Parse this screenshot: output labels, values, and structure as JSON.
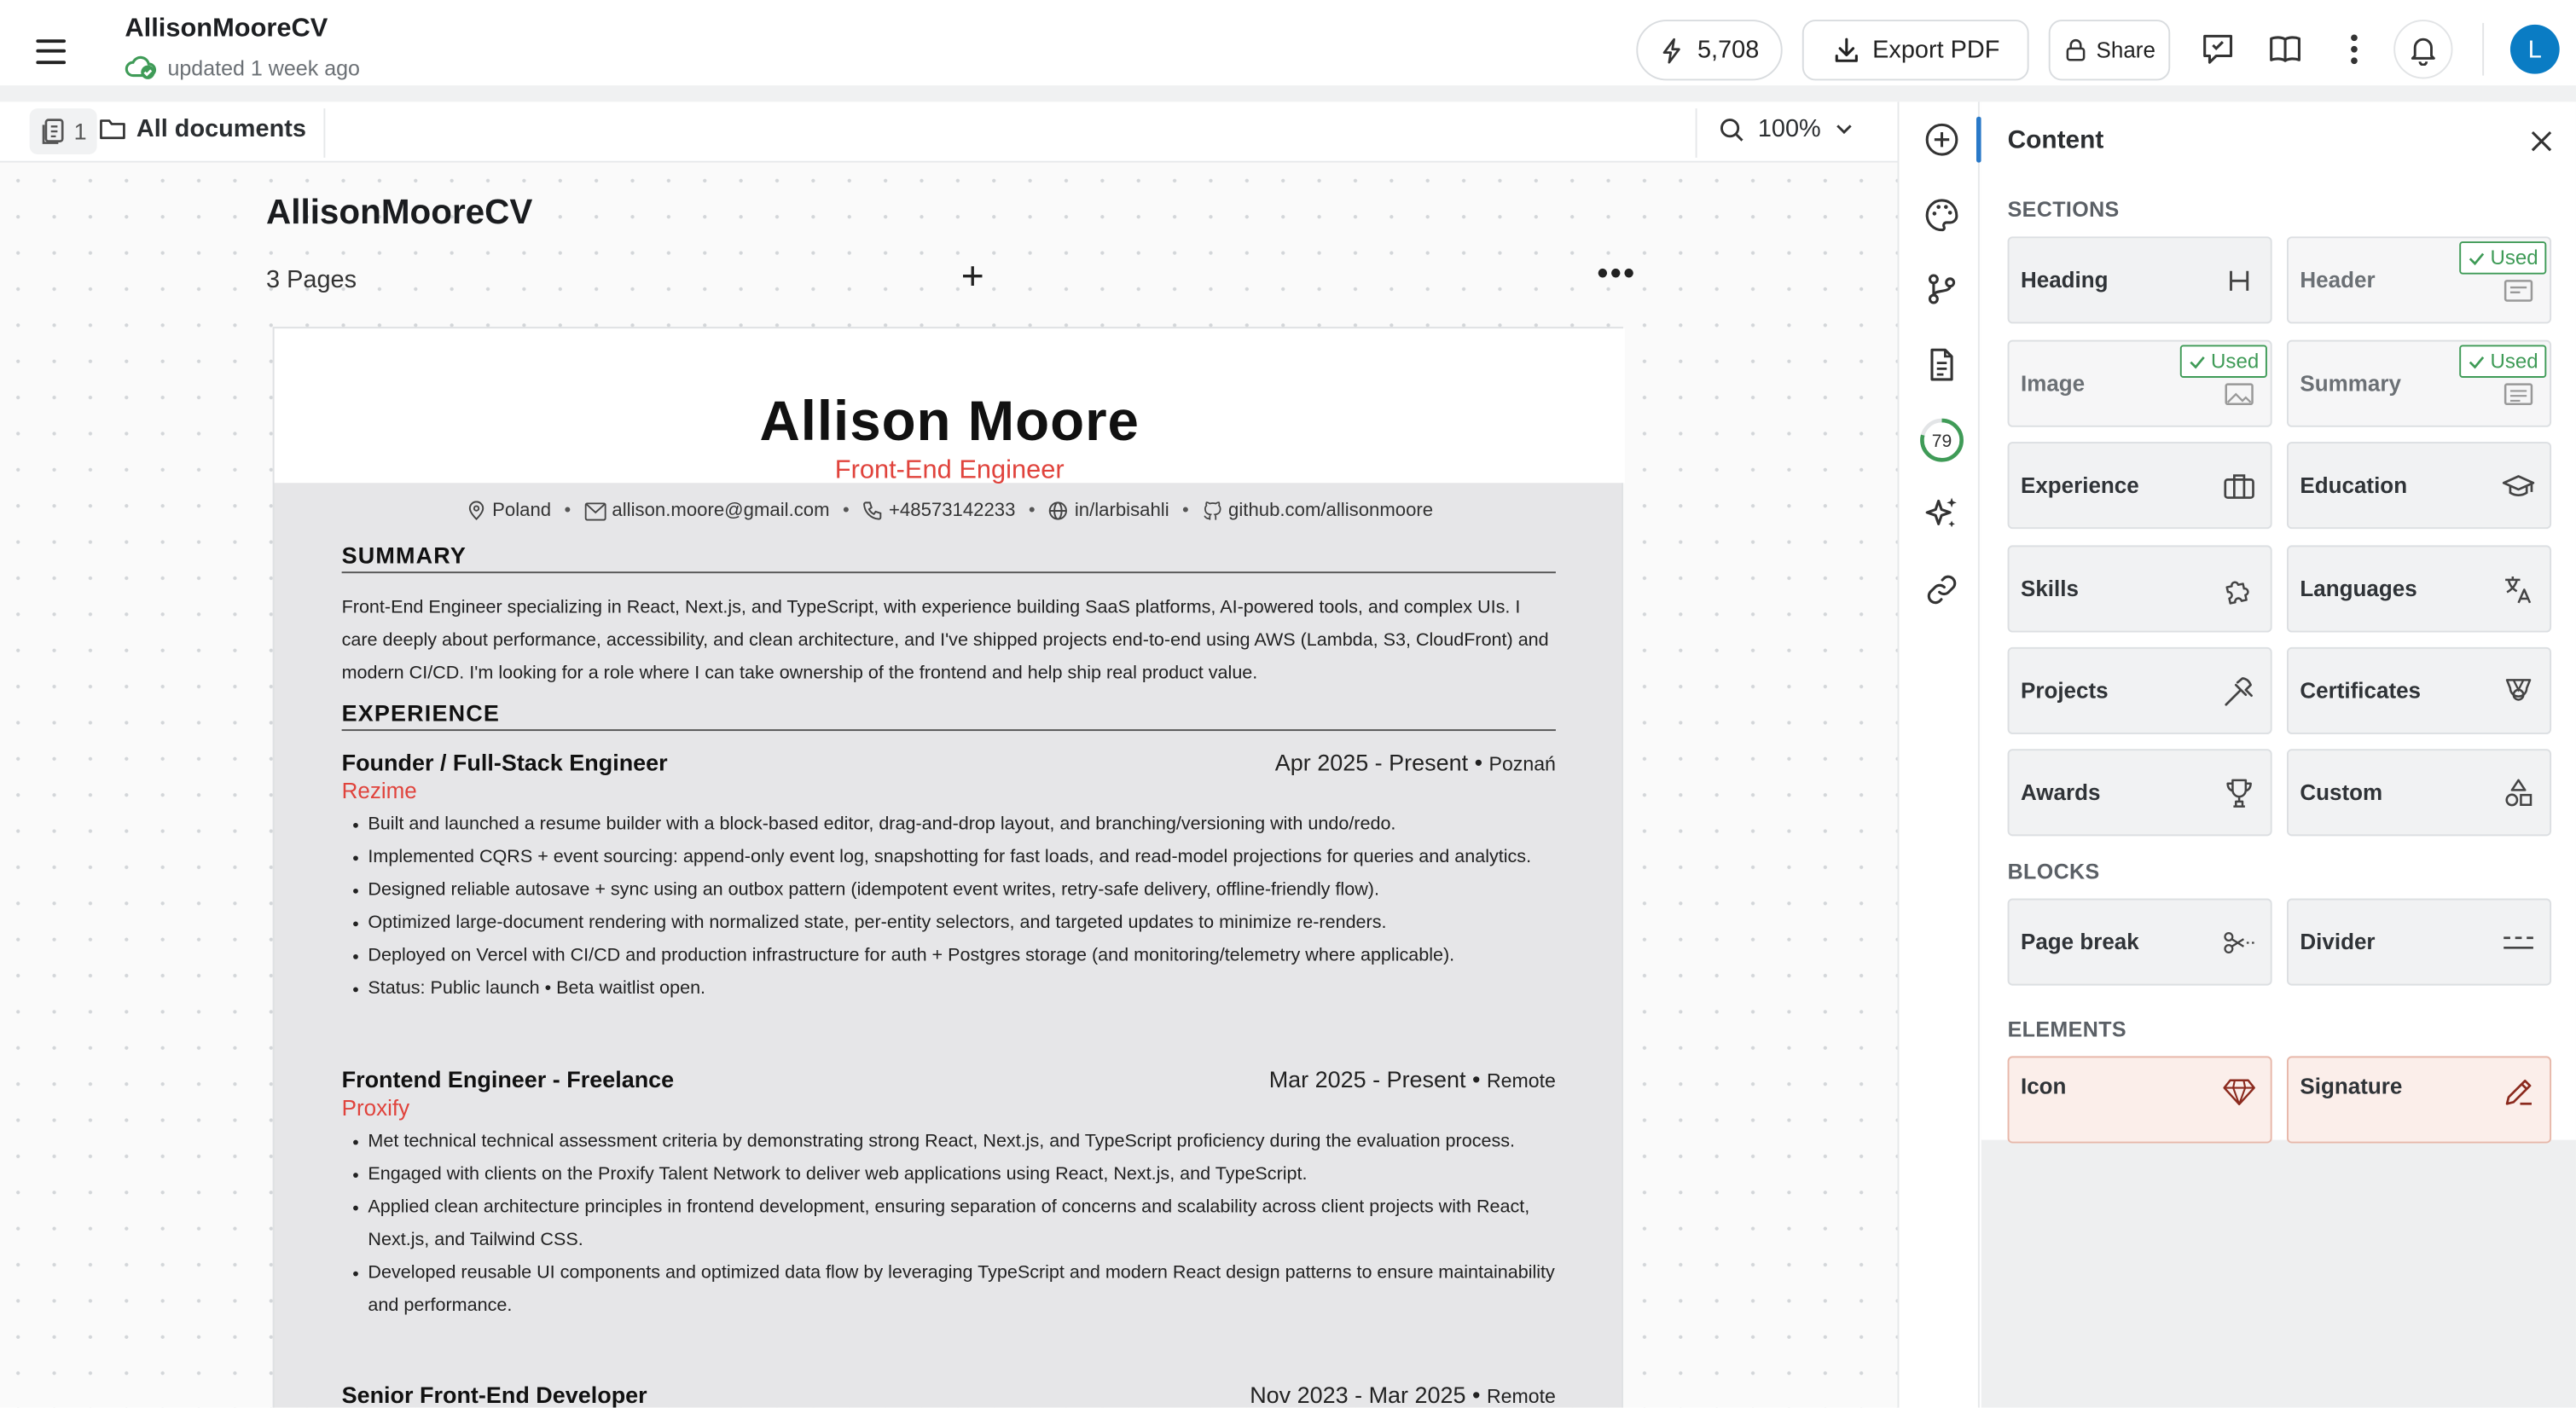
{
  "topbar": {
    "doc_title": "AllisonMooreCV",
    "status": "updated 1 week ago",
    "credits": "5,708",
    "export_label": "Export PDF",
    "share_label": "Share",
    "avatar_initial": "L"
  },
  "subbar": {
    "page_count": "1",
    "all_documents": "All documents",
    "zoom": "100%"
  },
  "canvas": {
    "title": "AllisonMooreCV",
    "pages_label": "3 Pages"
  },
  "resume": {
    "name": "Allison Moore",
    "role": "Front-End Engineer",
    "contacts": {
      "location": "Poland",
      "email": "allison.moore@gmail.com",
      "phone": "+48573142233",
      "linkedin": "in/larbisahli",
      "github": "github.com/allisonmoore"
    },
    "summary_heading": "SUMMARY",
    "summary": "Front-End Engineer specializing in React, Next.js, and TypeScript, with experience building SaaS platforms, AI-powered tools, and complex UIs. I care deeply about performance, accessibility, and clean architecture, and I've shipped projects end-to-end using AWS (Lambda, S3, CloudFront) and modern CI/CD. I'm looking for a role where I can take ownership of the frontend and help ship real product value.",
    "experience_heading": "EXPERIENCE",
    "jobs": [
      {
        "title": "Founder / Full-Stack Engineer",
        "dates": "Apr 2025 - Present",
        "location": "Poznań",
        "company": "Rezime",
        "bullets": [
          "Built and launched a resume builder with a block-based editor, drag-and-drop layout, and branching/versioning with undo/redo.",
          "Implemented CQRS + event sourcing: append-only event log, snapshotting for fast loads, and read-model projections for queries and analytics.",
          "Designed reliable autosave + sync using an outbox pattern (idempotent event writes, retry-safe delivery, offline-friendly flow).",
          "Optimized large-document rendering with normalized state, per-entity selectors, and targeted updates to minimize re-renders.",
          "Deployed on Vercel with CI/CD and production infrastructure for auth + Postgres storage (and monitoring/telemetry where applicable).",
          "Status: Public launch • Beta waitlist open."
        ]
      },
      {
        "title": "Frontend Engineer - Freelance",
        "dates": "Mar 2025 - Present",
        "location": "Remote",
        "company": "Proxify",
        "bullets": [
          "Met technical technical assessment criteria by demonstrating strong React, Next.js, and TypeScript proficiency during the evaluation process.",
          "Engaged with clients on the Proxify Talent Network to deliver web applications using React, Next.js, and TypeScript.",
          "Applied clean architecture principles in frontend development, ensuring separation of concerns and scalability across client projects with React, Next.js, and Tailwind CSS.",
          "Developed reusable UI components and optimized data flow by leveraging TypeScript and modern React design patterns to ensure maintainability and performance."
        ]
      },
      {
        "title": "Senior Front-End Developer",
        "dates": "Nov 2023 - Mar 2025",
        "location": "Remote",
        "company": "",
        "bullets": []
      }
    ]
  },
  "panel": {
    "title": "Content",
    "sections_heading": "SECTIONS",
    "blocks_heading": "BLOCKS",
    "elements_heading": "ELEMENTS",
    "used_label": "Used",
    "sections": [
      {
        "label": "Heading",
        "icon": "heading-icon",
        "used": false
      },
      {
        "label": "Header",
        "icon": "header-icon",
        "used": true
      },
      {
        "label": "Image",
        "icon": "image-icon",
        "used": true
      },
      {
        "label": "Summary",
        "icon": "summary-icon",
        "used": true
      },
      {
        "label": "Experience",
        "icon": "briefcase-icon",
        "used": false
      },
      {
        "label": "Education",
        "icon": "graduation-cap-icon",
        "used": false
      },
      {
        "label": "Skills",
        "icon": "puzzle-icon",
        "used": false
      },
      {
        "label": "Languages",
        "icon": "translate-icon",
        "used": false
      },
      {
        "label": "Projects",
        "icon": "hammer-icon",
        "used": false
      },
      {
        "label": "Certificates",
        "icon": "badge-icon",
        "used": false
      },
      {
        "label": "Awards",
        "icon": "trophy-icon",
        "used": false
      },
      {
        "label": "Custom",
        "icon": "shapes-icon",
        "used": false
      }
    ],
    "blocks": [
      {
        "label": "Page break",
        "icon": "scissors-icon"
      },
      {
        "label": "Divider",
        "icon": "divider-icon"
      }
    ],
    "elements": [
      {
        "label": "Icon",
        "icon": "gem-icon"
      },
      {
        "label": "Signature",
        "icon": "pen-icon"
      }
    ]
  },
  "rail": {
    "ats_score": "79"
  },
  "colors": {
    "accent_red": "#e0433c",
    "used_green": "#3f9b57",
    "brand_blue": "#0a7cc4",
    "rail_active": "#2979c8"
  }
}
